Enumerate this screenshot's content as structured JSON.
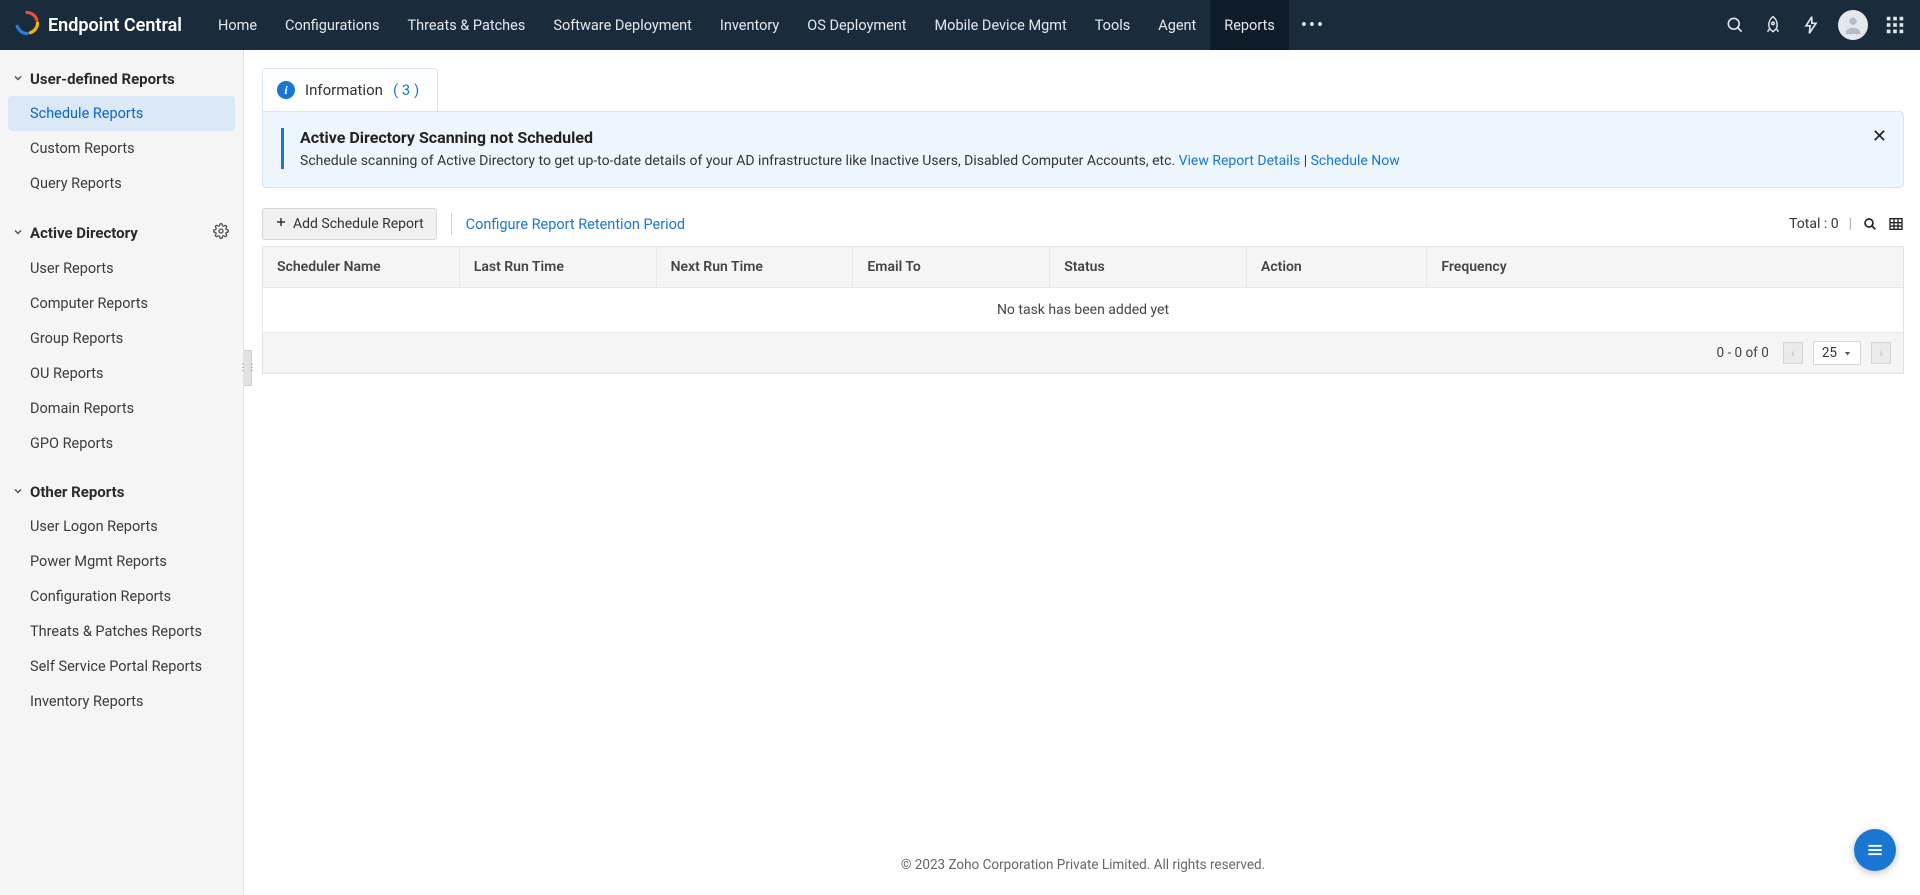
{
  "app": {
    "name": "Endpoint Central"
  },
  "nav": {
    "items": [
      {
        "label": "Home"
      },
      {
        "label": "Configurations"
      },
      {
        "label": "Threats & Patches"
      },
      {
        "label": "Software Deployment"
      },
      {
        "label": "Inventory"
      },
      {
        "label": "OS Deployment"
      },
      {
        "label": "Mobile Device Mgmt"
      },
      {
        "label": "Tools"
      },
      {
        "label": "Agent"
      },
      {
        "label": "Reports"
      }
    ],
    "active_index": 9
  },
  "sidebar": {
    "sections": [
      {
        "title": "User-defined Reports",
        "items": [
          {
            "label": "Schedule Reports",
            "active": true
          },
          {
            "label": "Custom Reports"
          },
          {
            "label": "Query Reports"
          }
        ]
      },
      {
        "title": "Active Directory",
        "has_gear": true,
        "items": [
          {
            "label": "User Reports"
          },
          {
            "label": "Computer Reports"
          },
          {
            "label": "Group Reports"
          },
          {
            "label": "OU Reports"
          },
          {
            "label": "Domain Reports"
          },
          {
            "label": "GPO Reports"
          }
        ]
      },
      {
        "title": "Other Reports",
        "items": [
          {
            "label": "User Logon Reports"
          },
          {
            "label": "Power Mgmt Reports"
          },
          {
            "label": "Configuration Reports"
          },
          {
            "label": "Threats & Patches Reports"
          },
          {
            "label": "Self Service Portal Reports"
          },
          {
            "label": "Inventory Reports"
          }
        ]
      }
    ]
  },
  "info_tab": {
    "label": "Information",
    "count": "( 3 )"
  },
  "alert": {
    "title": "Active Directory Scanning not Scheduled",
    "desc": "Schedule scanning of Active Directory to get up-to-date details of your AD infrastructure like Inactive Users, Disabled Computer Accounts, etc. ",
    "link1": "View Report Details",
    "sep": " | ",
    "link2": "Schedule Now"
  },
  "toolbar": {
    "add_label": "Add Schedule Report",
    "configure_label": "Configure Report Retention Period",
    "total_label": "Total : 0"
  },
  "table": {
    "headers": {
      "scheduler": "Scheduler Name",
      "last_run": "Last Run Time",
      "next_run": "Next Run Time",
      "email": "Email To",
      "status": "Status",
      "action": "Action",
      "frequency": "Frequency"
    },
    "empty": "No task has been added yet",
    "pager": {
      "range": "0 - 0 of 0",
      "page_size": "25"
    }
  },
  "footer": {
    "text": "© 2023 Zoho Corporation Private Limited.  All rights reserved."
  }
}
